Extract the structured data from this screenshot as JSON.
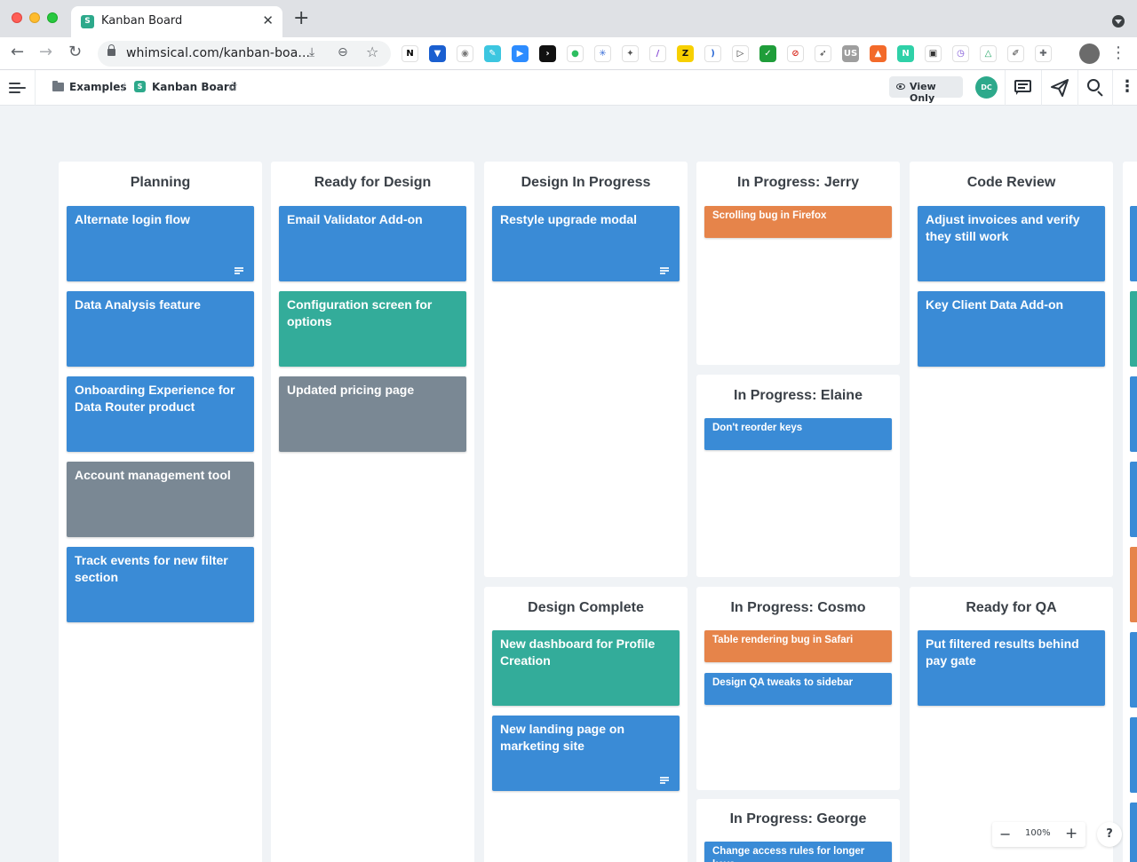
{
  "browser": {
    "tab_title": "Kanban Board",
    "tab_favicon": "S",
    "close_glyph": "✕",
    "new_tab_glyph": "+",
    "url": "whimsical.com/kanban-boa...",
    "nav": {
      "back": "←",
      "forward": "→",
      "reload": "↻"
    },
    "menu_glyph": "⋮",
    "extensions": [
      {
        "name": "notion-extension-icon",
        "bg": "#ffffff",
        "fg": "#000000",
        "glyph": "N"
      },
      {
        "name": "funnel-extension-icon",
        "bg": "#1a5fd0",
        "fg": "#ffffff",
        "glyph": "▼"
      },
      {
        "name": "camera-extension-icon",
        "bg": "#ffffff",
        "fg": "#7a7a7a",
        "glyph": "◉"
      },
      {
        "name": "pen-extension-icon",
        "bg": "#3cc6e0",
        "fg": "#ffffff",
        "glyph": "✎"
      },
      {
        "name": "zoom-extension-icon",
        "bg": "#2d8cff",
        "fg": "#ffffff",
        "glyph": "▶"
      },
      {
        "name": "terminal-extension-icon",
        "bg": "#111111",
        "fg": "#ffffff",
        "glyph": "›"
      },
      {
        "name": "evernote-extension-icon",
        "bg": "#ffffff",
        "fg": "#2dbe60",
        "glyph": "●"
      },
      {
        "name": "asterisk-extension-icon",
        "bg": "#ffffff",
        "fg": "#3b6fd8",
        "glyph": "✳"
      },
      {
        "name": "bird-extension-icon",
        "bg": "#ffffff",
        "fg": "#555555",
        "glyph": "✦"
      },
      {
        "name": "feather-extension-icon",
        "bg": "#ffffff",
        "fg": "#8b4fd6",
        "glyph": "/"
      },
      {
        "name": "z-extension-icon",
        "bg": "#f7d000",
        "fg": "#111111",
        "glyph": "Z"
      },
      {
        "name": "wave-extension-icon",
        "bg": "#ffffff",
        "fg": "#2d6bd6",
        "glyph": ")"
      },
      {
        "name": "play-extension-icon",
        "bg": "#ffffff",
        "fg": "#333333",
        "glyph": "▷"
      },
      {
        "name": "check-extension-icon",
        "bg": "#1f9d3a",
        "fg": "#ffffff",
        "glyph": "✓"
      },
      {
        "name": "block-extension-icon",
        "bg": "#ffffff",
        "fg": "#d93025",
        "glyph": "⊘"
      },
      {
        "name": "rocket-extension-icon",
        "bg": "#ffffff",
        "fg": "#333333",
        "glyph": "➶"
      },
      {
        "name": "us-extension-icon",
        "bg": "#9e9e9e",
        "fg": "#ffffff",
        "glyph": "US"
      },
      {
        "name": "brave-extension-icon",
        "bg": "#f36a2a",
        "fg": "#ffffff",
        "glyph": "▲"
      },
      {
        "name": "n-extension-icon",
        "bg": "#2fd1a8",
        "fg": "#ffffff",
        "glyph": "N"
      },
      {
        "name": "pip-extension-icon",
        "bg": "#ffffff",
        "fg": "#333333",
        "glyph": "▣"
      },
      {
        "name": "clock-extension-icon",
        "bg": "#ffffff",
        "fg": "#7a4fd6",
        "glyph": "◷"
      },
      {
        "name": "drive-extension-icon",
        "bg": "#ffffff",
        "fg": "#1fa463",
        "glyph": "△"
      },
      {
        "name": "edit-extension-icon",
        "bg": "#ffffff",
        "fg": "#333333",
        "glyph": "✐"
      },
      {
        "name": "puzzle-extension-icon",
        "bg": "#ffffff",
        "fg": "#5f6368",
        "glyph": "✚"
      }
    ]
  },
  "app": {
    "breadcrumb": {
      "folder": "Examples",
      "separator": "/",
      "board": "Kanban Board",
      "board_icon": "S"
    },
    "star_glyph": "☆",
    "view_only_label": "View Only",
    "avatar_initials": "DC",
    "kebab_glyph": "⋮"
  },
  "lanes": [
    {
      "key": "planning",
      "title": "Planning",
      "cards": [
        {
          "title": "Alternate login flow",
          "color": "blue",
          "notes": true
        },
        {
          "title": "Data Analysis feature",
          "color": "blue",
          "notes": false
        },
        {
          "title": "Onboarding Experience for Data Router product",
          "color": "blue",
          "notes": false
        },
        {
          "title": "Account management tool",
          "color": "gray",
          "notes": false
        },
        {
          "title": "Track events for new filter section",
          "color": "blue",
          "notes": false
        }
      ]
    },
    {
      "key": "ready-for-design",
      "title": "Ready for Design",
      "cards": [
        {
          "title": "Email Validator Add-on",
          "color": "blue",
          "notes": false
        },
        {
          "title": "Configuration screen for options",
          "color": "green",
          "notes": false
        },
        {
          "title": "Updated pricing page",
          "color": "gray",
          "notes": false
        }
      ]
    },
    {
      "key": "design-in-progress",
      "title": "Design In Progress",
      "cards": [
        {
          "title": "Restyle upgrade modal",
          "color": "blue",
          "notes": true
        }
      ]
    },
    {
      "key": "in-progress-jerry",
      "title": "In Progress: Jerry",
      "cards": [
        {
          "title": "Scrolling bug in Firefox",
          "color": "orange",
          "notes": false
        }
      ]
    },
    {
      "key": "code-review",
      "title": "Code Review",
      "cards": [
        {
          "title": "Adjust invoices and verify they still work",
          "color": "blue",
          "notes": false
        },
        {
          "title": "Key Client Data Add-on",
          "color": "blue",
          "notes": false
        }
      ]
    },
    {
      "key": "in-progress-elaine",
      "title": "In Progress: Elaine",
      "cards": [
        {
          "title": "Don't reorder keys",
          "color": "blue",
          "notes": false
        }
      ]
    },
    {
      "key": "design-complete",
      "title": "Design Complete",
      "cards": [
        {
          "title": "New dashboard for Profile Creation",
          "color": "green",
          "notes": false
        },
        {
          "title": "New landing page on marketing site",
          "color": "blue",
          "notes": true
        }
      ]
    },
    {
      "key": "in-progress-cosmo",
      "title": "In Progress: Cosmo",
      "cards": [
        {
          "title": "Table rendering bug in Safari",
          "color": "orange",
          "notes": false
        },
        {
          "title": "Design QA tweaks to sidebar",
          "color": "blue",
          "notes": false
        }
      ]
    },
    {
      "key": "ready-for-qa",
      "title": "Ready for QA",
      "cards": [
        {
          "title": "Put filtered results behind pay gate",
          "color": "blue",
          "notes": false
        }
      ]
    },
    {
      "key": "in-progress-george",
      "title": "In Progress: George",
      "cards": [
        {
          "title": "Change access rules for longer keys",
          "color": "blue",
          "notes": false
        }
      ]
    }
  ],
  "offscreen_lane_colors": [
    "#3a8bd6",
    "#33ac9a",
    "#3a8bd6",
    "#3a8bd6",
    "#e6844a",
    "#3a8bd6",
    "#3a8bd6",
    "#3a8bd6"
  ],
  "zoom": {
    "minus": "−",
    "value": "100%",
    "plus": "+"
  },
  "help_label": "?"
}
